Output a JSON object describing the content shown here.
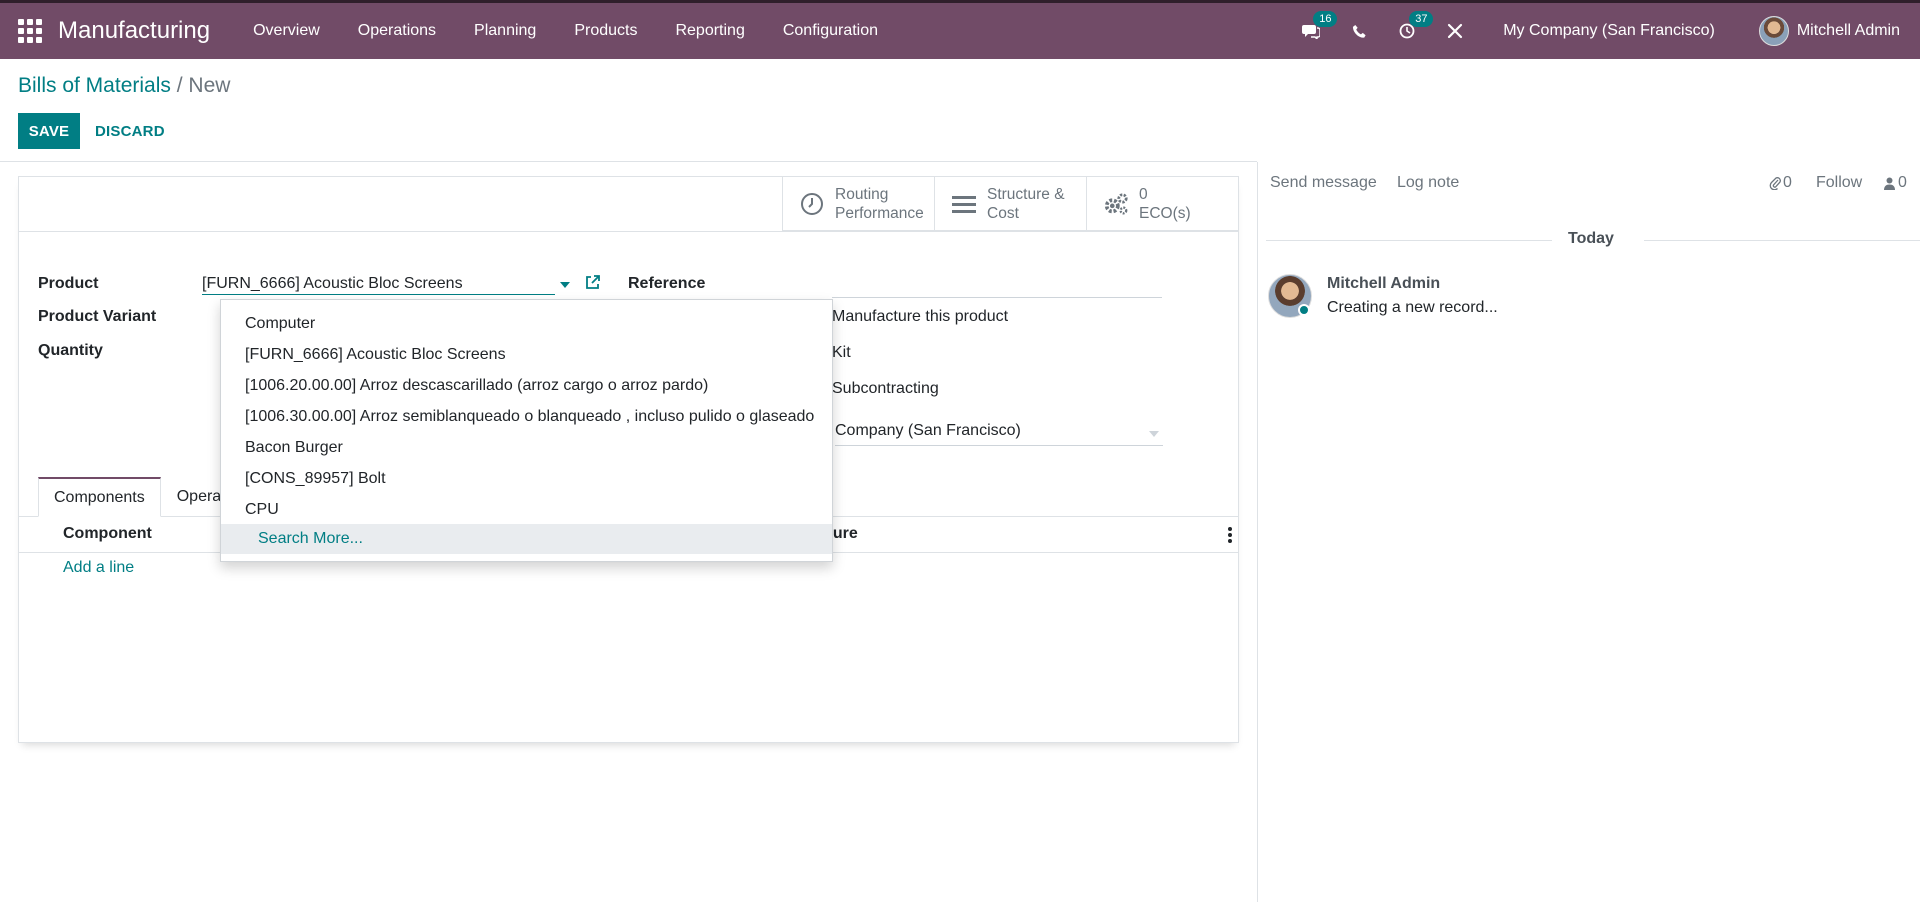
{
  "navbar": {
    "app_name": "Manufacturing",
    "menu": [
      "Overview",
      "Operations",
      "Planning",
      "Products",
      "Reporting",
      "Configuration"
    ],
    "messages_count": "16",
    "activities_count": "37",
    "company": "My Company (San Francisco)",
    "user": "Mitchell Admin",
    "brand_color": "#714b67",
    "accent_color": "#017e84"
  },
  "breadcrumb": {
    "parent": "Bills of Materials",
    "separator": "/",
    "current": "New"
  },
  "toolbar": {
    "save_label": "SAVE",
    "discard_label": "DISCARD"
  },
  "smart_buttons": {
    "routing_line1": "Routing",
    "routing_line2": "Performance",
    "structure_line1": "Structure &",
    "structure_line2": "Cost",
    "eco_count": "0",
    "eco_label": "ECO(s)"
  },
  "form": {
    "product_label": "Product",
    "product_value": "[FURN_6666] Acoustic Bloc Screens",
    "variant_label": "Product Variant",
    "quantity_label": "Quantity",
    "reference_label": "Reference",
    "type_options": [
      "Manufacture this product",
      "Kit",
      "Subcontracting"
    ],
    "company_value": "Company (San Francisco)"
  },
  "dropdown": {
    "items": [
      "Computer",
      "[FURN_6666] Acoustic Bloc Screens",
      "[1006.20.00.00] Arroz descascarillado (arroz cargo o arroz pardo)",
      "[1006.30.00.00] Arroz semiblanqueado o blanqueado , incluso pulido o glaseado",
      "Bacon Burger",
      "[CONS_89957] Bolt",
      "CPU"
    ],
    "search_more": "Search More..."
  },
  "notebook": {
    "tab_components": "Components",
    "tab_operations": "Operat",
    "col_component": "Component",
    "col_measure": "sure",
    "add_line": "Add a line"
  },
  "chatter": {
    "send_message": "Send message",
    "log_note": "Log note",
    "attachments": "0",
    "follow": "Follow",
    "followers": "0",
    "today": "Today",
    "author": "Mitchell Admin",
    "body": "Creating a new record..."
  }
}
